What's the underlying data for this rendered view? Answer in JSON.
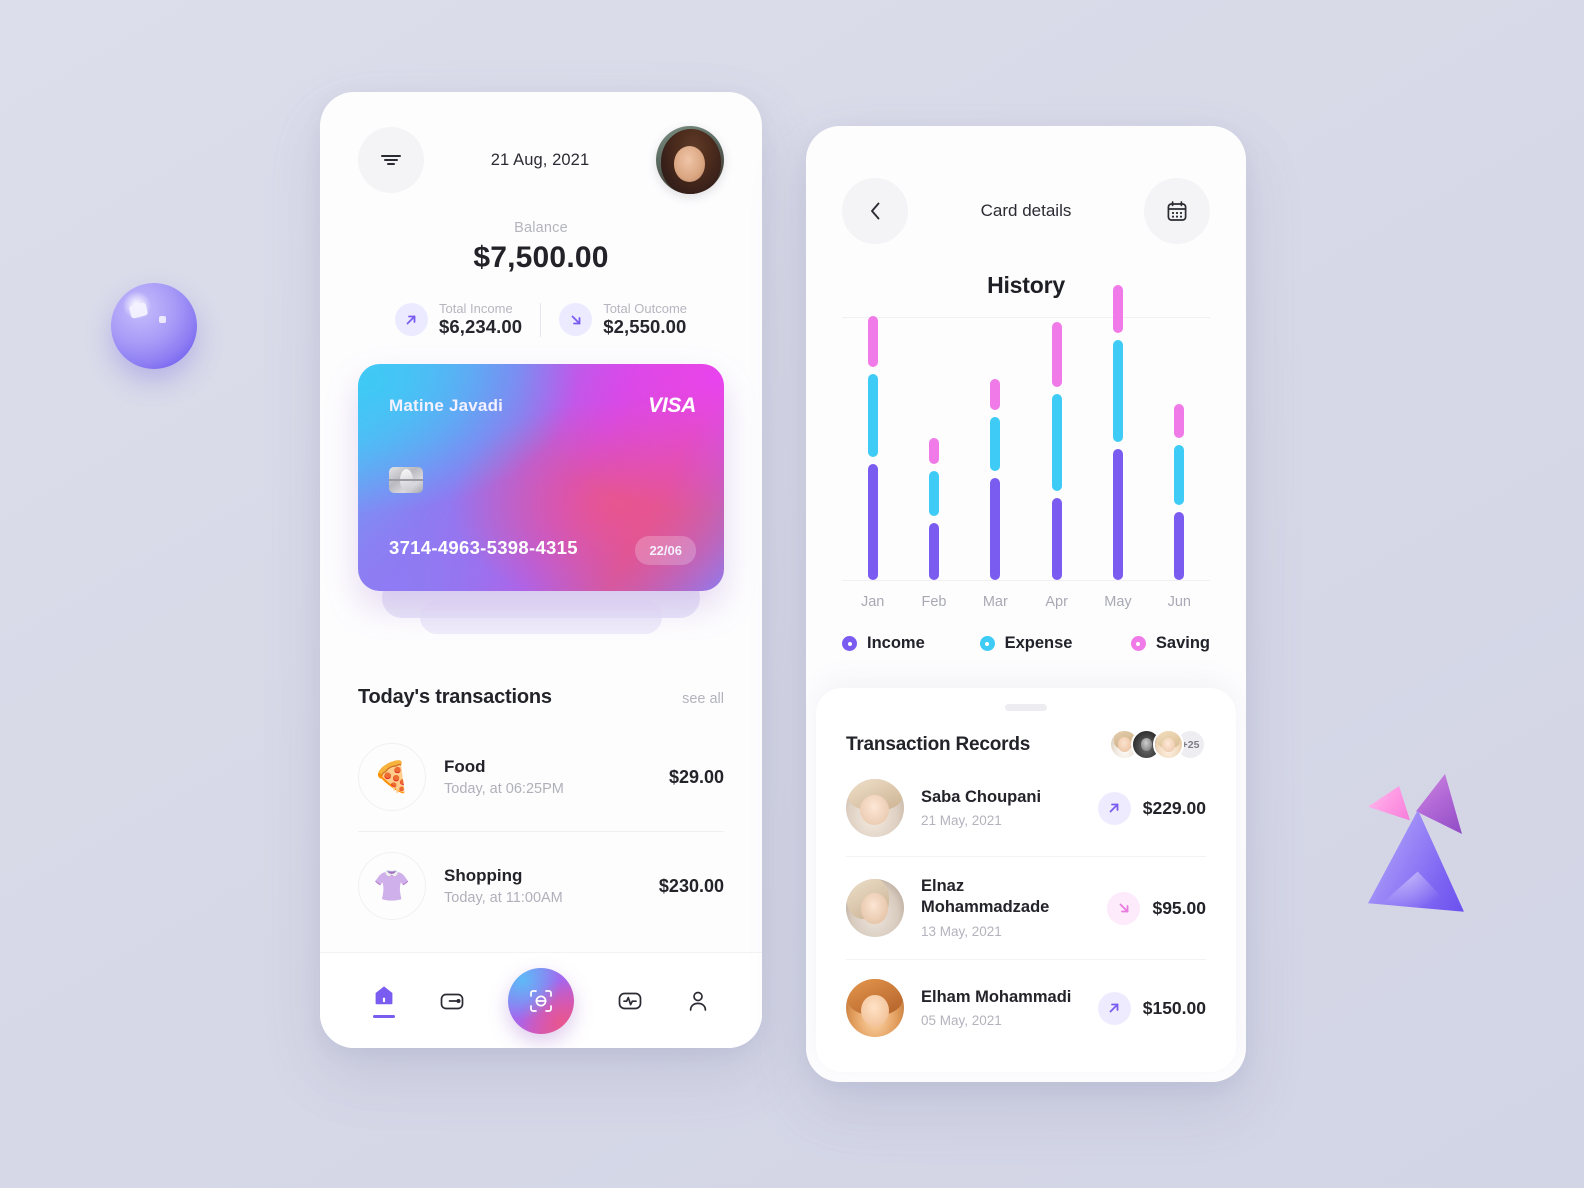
{
  "colors": {
    "background": "#d9dbe9",
    "income": "#7b5cf0",
    "expense": "#3ecbf5",
    "saving": "#f07ae8",
    "accent": "#7b5cf0"
  },
  "left_phone": {
    "header": {
      "filter_icon": "filter-icon",
      "date": "21 Aug, 2021",
      "avatar": "user-avatar"
    },
    "balance": {
      "label": "Balance",
      "value": "$7,500.00"
    },
    "stats": [
      {
        "label": "Total Income",
        "value": "$6,234.00",
        "icon": "arrow-up-right-icon"
      },
      {
        "label": "Total Outcome",
        "value": "$2,550.00",
        "icon": "arrow-down-right-icon"
      }
    ],
    "card": {
      "holder": "Matine Javadi",
      "brand": "VISA",
      "number": "3714-4963-5398-4315",
      "expiry": "22/06",
      "chip": "card-chip-icon"
    },
    "transactions_section": {
      "title": "Today's transactions",
      "see_all": "see all",
      "items": [
        {
          "icon": "🍕",
          "name": "Food",
          "time": "Today, at 06:25PM",
          "amount": "$29.00"
        },
        {
          "icon": "👚",
          "name": "Shopping",
          "time": "Today, at 11:00AM",
          "amount": "$230.00"
        }
      ]
    },
    "tabbar": [
      {
        "name": "home-icon",
        "active": true
      },
      {
        "name": "wallet-icon",
        "active": false
      },
      {
        "name": "scan-icon",
        "active": false
      },
      {
        "name": "activity-icon",
        "active": false
      },
      {
        "name": "profile-icon",
        "active": false
      }
    ]
  },
  "right_phone": {
    "header": {
      "back_icon": "chevron-left-icon",
      "title": "Card details",
      "calendar_icon": "calendar-icon"
    },
    "history_title": "History",
    "legend": [
      {
        "label": "Income",
        "color": "#7b5cf0"
      },
      {
        "label": "Expense",
        "color": "#3ecbf5"
      },
      {
        "label": "Saving",
        "color": "#f07ae8"
      }
    ],
    "records": {
      "title": "Transaction Records",
      "more_count": "+25",
      "stack_avatars": [
        "avatar-1",
        "avatar-2",
        "avatar-3"
      ],
      "rows": [
        {
          "name": "Saba Choupani",
          "date": "21 May, 2021",
          "amount": "$229.00",
          "direction": "in",
          "icon": "arrow-up-right-icon"
        },
        {
          "name": "Elnaz Mohammadzade",
          "date": "13 May, 2021",
          "amount": "$95.00",
          "direction": "out",
          "icon": "arrow-down-right-icon"
        },
        {
          "name": "Elham Mohammadi",
          "date": "05 May, 2021",
          "amount": "$150.00",
          "direction": "in",
          "icon": "arrow-up-right-icon"
        }
      ]
    }
  },
  "chart_data": {
    "type": "bar",
    "title": "History",
    "xlabel": "",
    "ylabel": "",
    "grid": false,
    "legend_position": "below",
    "categories": [
      "Jan",
      "Feb",
      "Mar",
      "Apr",
      "May",
      "Jun"
    ],
    "series": [
      {
        "name": "Income",
        "color": "#7b5cf0",
        "values": [
          82,
          40,
          72,
          58,
          92,
          48
        ]
      },
      {
        "name": "Expense",
        "color": "#3ecbf5",
        "values": [
          58,
          32,
          38,
          68,
          72,
          42
        ]
      },
      {
        "name": "Saving",
        "color": "#f07ae8",
        "values": [
          36,
          18,
          22,
          46,
          34,
          24
        ]
      }
    ],
    "note": "Stacked vertical bars, each segment separated by a small gap; values are relative pixel-derived magnitudes."
  }
}
